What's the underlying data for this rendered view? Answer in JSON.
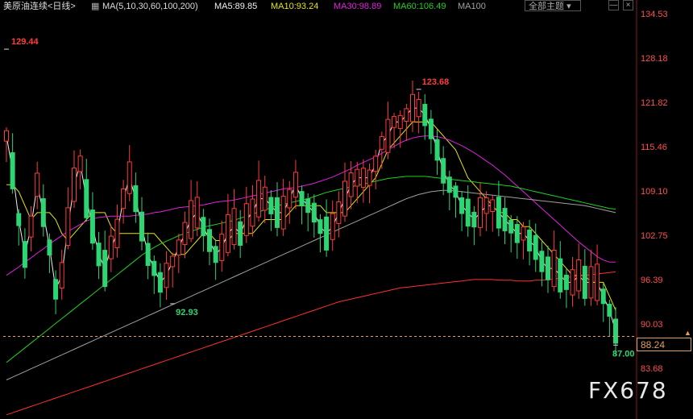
{
  "header": {
    "title": "美原油连续<日线>",
    "ma_label": "MA(5,10,30,60,100,200)",
    "ma5": "MA5:89.85",
    "ma10": "MA10:93.24",
    "ma30": "MA30:98.89",
    "ma60": "MA60:106.49",
    "ma100": "MA100",
    "theme_button": "全部主题",
    "min_btn": "—",
    "close_btn": "×"
  },
  "watermark": "FX678",
  "price_tag": "88.24",
  "colors": {
    "background": "#000000",
    "up": "#ff3b3b",
    "down": "#2ed573",
    "ma5": "#f0f0f0",
    "ma10": "#e6e600",
    "ma30": "#e020e0",
    "ma60": "#20d020",
    "ma100": "#a0a0a0",
    "ma200": "#ff3030",
    "current_price": "#e0a060",
    "axis_text": "#ff5050"
  },
  "chart_data": {
    "type": "candlestick",
    "title": "美原油连续<日线>",
    "ylim": [
      83.68,
      134.53
    ],
    "y_ticks": [
      "134.53",
      "128.18",
      "121.82",
      "115.46",
      "109.10",
      "102.75",
      "96.39",
      "90.03",
      "83.68"
    ],
    "annotations": [
      {
        "text": "129.44",
        "kind": "high"
      },
      {
        "text": "92.93",
        "kind": "low"
      },
      {
        "text": "123.68",
        "kind": "high"
      },
      {
        "text": "87.00",
        "kind": "low"
      }
    ],
    "current_price": 88.24,
    "series": [
      {
        "name": "MA5",
        "values": [
          117,
          112,
          105,
          100,
          104,
          110,
          106,
          101,
          95,
          97,
          104,
          110,
          113,
          108,
          104,
          100,
          98,
          101,
          103,
          108,
          111,
          108,
          104,
          100,
          98,
          96,
          97,
          99,
          101,
          103,
          105,
          106,
          104,
          102,
          100,
          101,
          103,
          104,
          103,
          105,
          106,
          108,
          108,
          107,
          106,
          106,
          108,
          110,
          108,
          107,
          106,
          104,
          103,
          104,
          106,
          108,
          110,
          111,
          111,
          111,
          113,
          116,
          117,
          119,
          119,
          120,
          121,
          121,
          120,
          118,
          115,
          112,
          110,
          109,
          107,
          106,
          105,
          106,
          107,
          107,
          106,
          105,
          104,
          103,
          103,
          102,
          101,
          99,
          98,
          98,
          97,
          96,
          96,
          97,
          96,
          96,
          96,
          94,
          92,
          89
        ]
      },
      {
        "name": "MA10",
        "values": [
          110,
          110,
          109,
          107,
          105,
          106,
          106,
          106,
          105,
          103,
          102,
          103,
          104,
          105,
          106,
          106,
          106,
          104,
          103,
          103,
          103,
          103,
          103,
          103,
          103,
          102,
          101,
          100,
          100,
          100,
          101,
          102,
          103,
          103,
          102,
          102,
          102,
          103,
          103,
          103,
          103,
          104,
          105,
          105,
          105,
          105,
          106,
          107,
          107,
          107,
          107,
          107,
          106,
          106,
          106,
          106,
          107,
          108,
          109,
          110,
          111,
          113,
          115,
          116,
          117,
          118,
          119,
          119,
          119,
          119,
          118,
          117,
          116,
          115,
          113,
          111,
          110,
          109,
          108,
          107,
          106,
          106,
          105,
          105,
          104,
          104,
          103,
          102,
          101,
          100,
          99,
          98,
          97,
          97,
          97,
          96,
          96,
          96,
          94,
          92
        ]
      },
      {
        "name": "MA30",
        "values": [
          97,
          97.6,
          98.2,
          98.9,
          99.5,
          100.2,
          100.8,
          101.5,
          102.1,
          102.7,
          103.3,
          103.8,
          104.3,
          104.8,
          105.1,
          105.3,
          105.4,
          105.5,
          105.5,
          105.5,
          105.5,
          105.6,
          105.7,
          105.8,
          106.0,
          106.1,
          106.3,
          106.5,
          106.7,
          106.8,
          106.9,
          107.0,
          107.1,
          107.3,
          107.5,
          107.6,
          107.7,
          107.8,
          108.0,
          108.2,
          108.4,
          108.6,
          108.8,
          109.0,
          109.2,
          109.4,
          109.5,
          109.6,
          109.8,
          110.0,
          110.2,
          110.5,
          110.8,
          111.1,
          111.5,
          111.9,
          112.3,
          112.8,
          113.2,
          113.6,
          114.0,
          114.5,
          115.0,
          115.5,
          116.0,
          116.4,
          116.7,
          116.9,
          117.0,
          117.0,
          116.9,
          116.7,
          116.4,
          116.0,
          115.6,
          115.1,
          114.6,
          114.0,
          113.4,
          112.8,
          112.1,
          111.4,
          110.6,
          109.8,
          109.0,
          108.2,
          107.4,
          106.6,
          105.8,
          105.0,
          104.2,
          103.4,
          102.6,
          101.8,
          101.1,
          100.4,
          99.7,
          99.2,
          98.9,
          98.9
        ]
      },
      {
        "name": "MA60",
        "values": [
          84.5,
          85.2,
          85.9,
          86.6,
          87.3,
          88.0,
          88.7,
          89.4,
          90.1,
          90.8,
          91.5,
          92.2,
          92.9,
          93.6,
          94.3,
          95.0,
          95.7,
          96.4,
          97.1,
          97.8,
          98.5,
          99.2,
          99.9,
          100.5,
          101.0,
          101.5,
          101.9,
          102.3,
          102.7,
          103.0,
          103.3,
          103.6,
          103.9,
          104.1,
          104.3,
          104.5,
          104.7,
          104.9,
          105.2,
          105.5,
          105.8,
          106.1,
          106.4,
          106.7,
          107.0,
          107.2,
          107.4,
          107.6,
          107.8,
          108.0,
          108.3,
          108.6,
          108.9,
          109.1,
          109.3,
          109.5,
          109.7,
          109.9,
          110.1,
          110.3,
          110.5,
          110.7,
          110.9,
          111.0,
          111.1,
          111.2,
          111.2,
          111.2,
          111.2,
          111.1,
          111.0,
          110.9,
          110.8,
          110.7,
          110.6,
          110.5,
          110.4,
          110.3,
          110.2,
          110.1,
          110.0,
          109.9,
          109.8,
          109.6,
          109.4,
          109.2,
          109.0,
          108.8,
          108.6,
          108.4,
          108.2,
          108.0,
          107.8,
          107.6,
          107.4,
          107.2,
          107.0,
          106.8,
          106.6,
          106.5
        ]
      },
      {
        "name": "MA100",
        "values": [
          82.0,
          82.4,
          82.8,
          83.2,
          83.6,
          84.0,
          84.4,
          84.8,
          85.2,
          85.6,
          86.0,
          86.4,
          86.8,
          87.2,
          87.6,
          88.0,
          88.4,
          88.8,
          89.2,
          89.6,
          90.0,
          90.4,
          90.8,
          91.2,
          91.6,
          92.0,
          92.4,
          92.8,
          93.2,
          93.6,
          94.0,
          94.4,
          94.8,
          95.2,
          95.6,
          96.0,
          96.4,
          96.8,
          97.2,
          97.6,
          98.0,
          98.4,
          98.8,
          99.2,
          99.6,
          100.0,
          100.4,
          100.8,
          101.2,
          101.6,
          102.0,
          102.4,
          102.8,
          103.2,
          103.6,
          104.0,
          104.4,
          104.8,
          105.2,
          105.6,
          106.0,
          106.4,
          106.8,
          107.2,
          107.6,
          108.0,
          108.3,
          108.6,
          108.8,
          109.0,
          109.1,
          109.2,
          109.2,
          109.1,
          109.0,
          108.9,
          108.8,
          108.7,
          108.6,
          108.5,
          108.4,
          108.3,
          108.2,
          108.1,
          108.0,
          107.9,
          107.8,
          107.7,
          107.6,
          107.5,
          107.4,
          107.3,
          107.2,
          107.1,
          107.0,
          106.8,
          106.6,
          106.4,
          106.2,
          106.0
        ]
      },
      {
        "name": "MA200",
        "values": [
          77.0,
          77.3,
          77.6,
          77.9,
          78.2,
          78.5,
          78.8,
          79.1,
          79.4,
          79.7,
          80.0,
          80.3,
          80.6,
          80.9,
          81.2,
          81.5,
          81.8,
          82.1,
          82.4,
          82.7,
          83.0,
          83.3,
          83.6,
          83.9,
          84.2,
          84.5,
          84.8,
          85.1,
          85.4,
          85.7,
          86.0,
          86.3,
          86.6,
          86.9,
          87.2,
          87.5,
          87.8,
          88.1,
          88.4,
          88.7,
          89.0,
          89.3,
          89.6,
          89.9,
          90.2,
          90.5,
          90.8,
          91.1,
          91.4,
          91.7,
          92.0,
          92.3,
          92.6,
          92.9,
          93.2,
          93.4,
          93.6,
          93.8,
          94.0,
          94.2,
          94.4,
          94.6,
          94.8,
          95.0,
          95.2,
          95.3,
          95.4,
          95.5,
          95.6,
          95.7,
          95.8,
          95.9,
          96.0,
          96.1,
          96.2,
          96.3,
          96.4,
          96.4,
          96.4,
          96.4,
          96.3,
          96.3,
          96.3,
          96.2,
          96.2,
          96.2,
          96.3,
          96.3,
          96.4,
          96.5,
          96.6,
          96.7,
          96.8,
          96.9,
          97.0,
          97.1,
          97.2,
          97.3,
          97.4,
          97.5
        ]
      }
    ]
  }
}
